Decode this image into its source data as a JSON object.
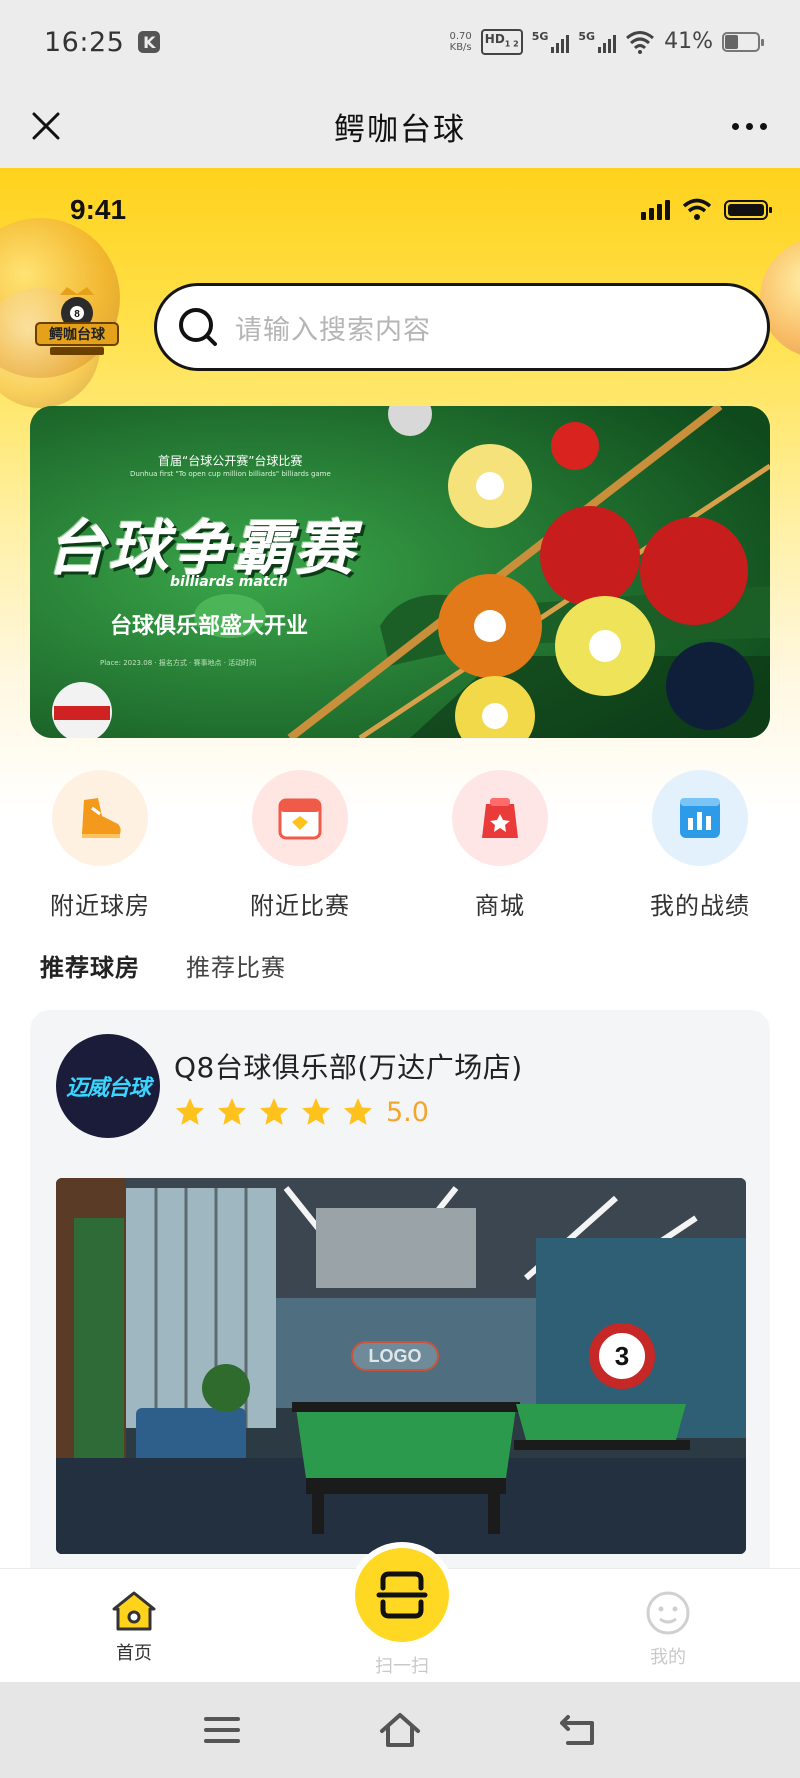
{
  "system_status": {
    "time": "16:25",
    "app_badge": "K",
    "net_speed_value": "0.70",
    "net_speed_unit": "KB/s",
    "hd_label": "HD",
    "hd_sub": "1 2",
    "sim1_label": "5G",
    "sim2_label": "5G",
    "battery_pct": "41%",
    "battery_level": 0.41
  },
  "titlebar": {
    "title": "鳄咖台球"
  },
  "header": {
    "inner_time": "9:41",
    "logo_text": "鳄咖台球",
    "search_placeholder": "请输入搜索内容"
  },
  "banner": {
    "small_title": "首届“台球公开赛”台球比赛",
    "small_en": "Dunhua first \"To open cup million billiards\" billiards game",
    "title": "台球争霸赛",
    "title_en": "billiards match",
    "subtitle": "台球俱乐部盛大开业",
    "tiny_text": "Place: 2023.08 · 报名方式 · 赛事地点 · 活动时间"
  },
  "quick_entries": [
    {
      "label": "附近球房",
      "icon": "shoe-icon",
      "bg": "#fff1e2"
    },
    {
      "label": "附近比赛",
      "icon": "calendar-icon",
      "bg": "#ffe6e3"
    },
    {
      "label": "商城",
      "icon": "shop-bag-icon",
      "bg": "#ffe6e6"
    },
    {
      "label": "我的战绩",
      "icon": "bar-chart-icon",
      "bg": "#e3f1fc"
    }
  ],
  "tabs": {
    "recommended_rooms": "推荐球房",
    "recommended_matches": "推荐比赛"
  },
  "club": {
    "logo_text": "迈威台球",
    "name": "Q8台球俱乐部(万达广场店)",
    "rating": "5.0",
    "stars": 5,
    "photo_logo_text": "LOGO",
    "photo_ball_number": "3"
  },
  "tabbar": {
    "home": "首页",
    "scan": "扫一扫",
    "mine": "我的"
  },
  "colors": {
    "brand_yellow": "#ffd21c",
    "rating_orange": "#f3a62c",
    "tab_green": "#4cc769"
  }
}
